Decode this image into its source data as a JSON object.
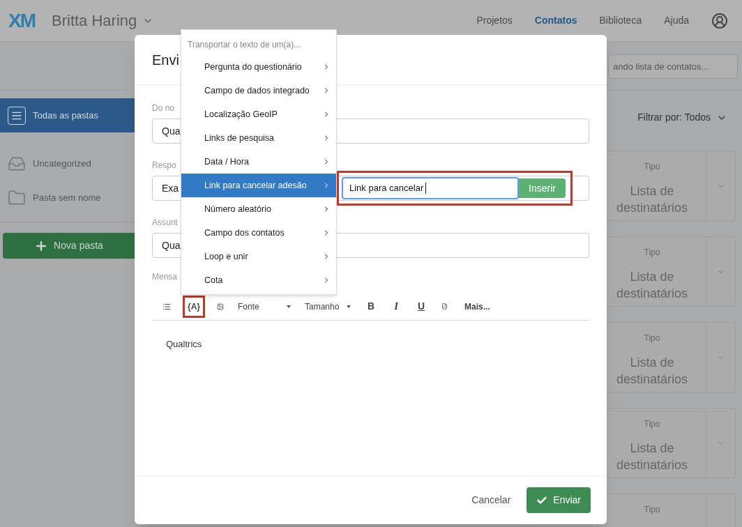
{
  "header": {
    "logo": "XM",
    "account": "Britta Haring",
    "nav": [
      {
        "label": "Projetos",
        "selected": false
      },
      {
        "label": "Contatos",
        "selected": true
      },
      {
        "label": "Biblioteca",
        "selected": false
      },
      {
        "label": "Ajuda",
        "selected": false
      }
    ]
  },
  "search": {
    "placeholder": "ando lista de contatos..."
  },
  "sidebar": {
    "folders": [
      {
        "label": "Todas as pastas",
        "kind": "all",
        "selected": true
      },
      {
        "label": "Uncategorized",
        "kind": "tray",
        "selected": false
      },
      {
        "label": "Pasta sem nome",
        "kind": "folder",
        "selected": false
      }
    ],
    "new_folder_button": "Nova pasta"
  },
  "filter": "Filtrar por: Todos",
  "cards": [
    {
      "label": "Tipo",
      "value": "Lista de destinatários"
    },
    {
      "label": "Tipo",
      "value": "Lista de destinatários"
    },
    {
      "label": "Tipo",
      "value": "Lista de destinatários"
    },
    {
      "label": "Tipo",
      "value": "Lista de destinatários"
    },
    {
      "label": "Tipo"
    }
  ],
  "dialog": {
    "title": "Envi",
    "fields": [
      {
        "label": "Do no",
        "value": "Qua"
      },
      {
        "label": "Respo",
        "value": "Exa"
      },
      {
        "label": "Assunt",
        "value": "Qua"
      }
    ],
    "message_label": "Mensa",
    "toolbar": [
      {
        "kind": "list"
      },
      {
        "kind": "text",
        "label": "{A}",
        "highlighted": true
      },
      {
        "kind": "image"
      },
      {
        "kind": "dropdown",
        "label": "Fonte"
      },
      {
        "kind": "dropdown",
        "label": "Tamanho"
      },
      {
        "kind": "bold",
        "label": "B"
      },
      {
        "kind": "italic",
        "label": "I"
      },
      {
        "kind": "underline",
        "label": "U"
      },
      {
        "kind": "source"
      },
      {
        "kind": "text",
        "label": "Mais..."
      }
    ],
    "editor_text": "Qualtrics",
    "cancel_button": "Cancelar",
    "send_button": "Enviar"
  },
  "menu": {
    "header": "Transportar o texto de um(a)...",
    "items": [
      {
        "label": "Pergunta do questionário",
        "selected": false
      },
      {
        "label": "Campo de dados integrado",
        "selected": false
      },
      {
        "label": "Localização GeoIP",
        "selected": false
      },
      {
        "label": "Links de pesquisa",
        "selected": false
      },
      {
        "label": "Data / Hora",
        "selected": false
      },
      {
        "label": "Link para cancelar adesão",
        "selected": true
      },
      {
        "label": "Número aleatório",
        "selected": false
      },
      {
        "label": "Campo dos contatos",
        "selected": false
      },
      {
        "label": "Loop e unir",
        "selected": false
      },
      {
        "label": "Cota",
        "selected": false
      }
    ]
  },
  "submenu": {
    "value": "Link para cancelar",
    "button": "Inserir",
    "highlighted": true
  }
}
